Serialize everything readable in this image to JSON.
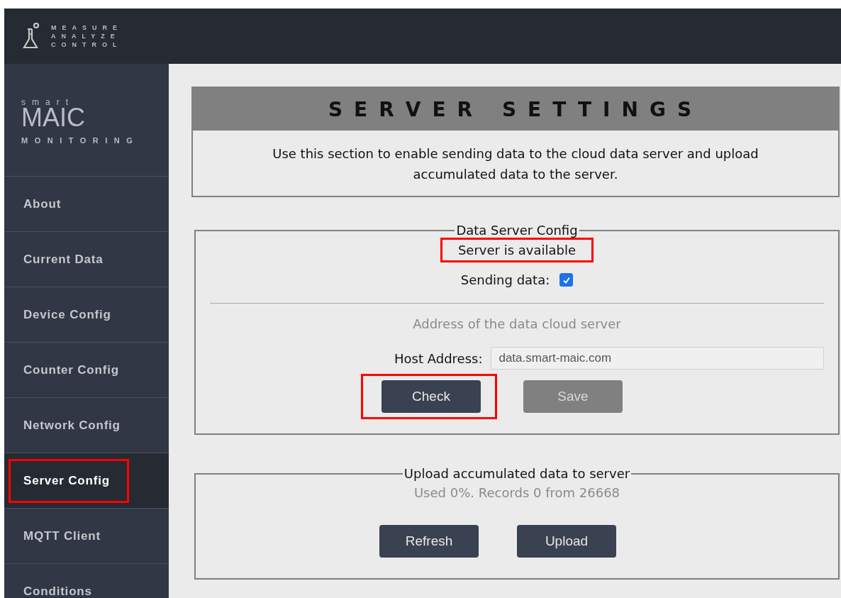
{
  "header": {
    "logo_lines": [
      "MEASURE",
      "ANALYZE",
      "CONTROL"
    ]
  },
  "brand": {
    "top": "smart",
    "name": "MAIC",
    "sub": "MONITORING"
  },
  "sidebar": {
    "items": [
      {
        "label": "About",
        "selected": false,
        "highlighted": false
      },
      {
        "label": "Current Data",
        "selected": false,
        "highlighted": false
      },
      {
        "label": "Device Config",
        "selected": false,
        "highlighted": false
      },
      {
        "label": "Counter Config",
        "selected": false,
        "highlighted": false
      },
      {
        "label": "Network Config",
        "selected": false,
        "highlighted": false
      },
      {
        "label": "Server Config",
        "selected": true,
        "highlighted": true
      },
      {
        "label": "MQTT Client",
        "selected": false,
        "highlighted": false
      },
      {
        "label": "Conditions",
        "selected": false,
        "highlighted": false
      }
    ]
  },
  "page": {
    "title": "SERVER SETTINGS",
    "description": "Use this section to enable sending data to the cloud data server and upload accumulated data to the server."
  },
  "data_server": {
    "legend": "Data Server Config",
    "status": "Server is available",
    "status_highlighted": true,
    "sending_label": "Sending data:",
    "sending_checked": true,
    "hint": "Address of the data cloud server",
    "host_label": "Host Address:",
    "host_value": "data.smart-maic.com",
    "buttons": [
      {
        "label": "Check",
        "disabled": false,
        "highlighted": true
      },
      {
        "label": "Save",
        "disabled": true,
        "highlighted": false
      }
    ]
  },
  "upload": {
    "legend": "Upload accumulated data to server",
    "usage": "Used 0%. Records 0 from 26668",
    "buttons": [
      {
        "label": "Refresh",
        "disabled": false,
        "highlighted": false
      },
      {
        "label": "Upload",
        "disabled": false,
        "highlighted": false
      }
    ]
  }
}
